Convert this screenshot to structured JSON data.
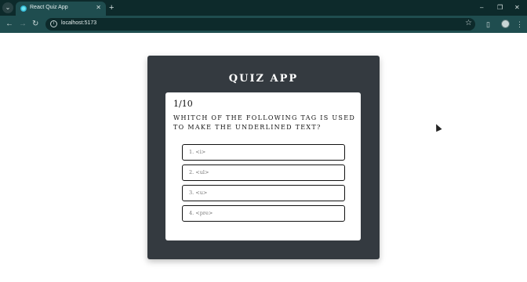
{
  "browser": {
    "tab_title": "React Quiz App",
    "url": "localhost:5173",
    "new_tab_symbol": "+",
    "tab_close_symbol": "✕",
    "minimize_symbol": "–",
    "restore_symbol": "❐",
    "close_symbol": "✕"
  },
  "quiz": {
    "title": "QUIZ APP",
    "counter": "1/10",
    "question": "Whitch of the following tag is used to make the underlined text?",
    "options": [
      "1. <i>",
      "2. <ul>",
      "3. <u>",
      "4. <pre>"
    ]
  },
  "colors": {
    "card_bg": "#343a40",
    "chrome_bg": "#1f4d4f",
    "tabbar_bg": "#0d2a2b"
  }
}
